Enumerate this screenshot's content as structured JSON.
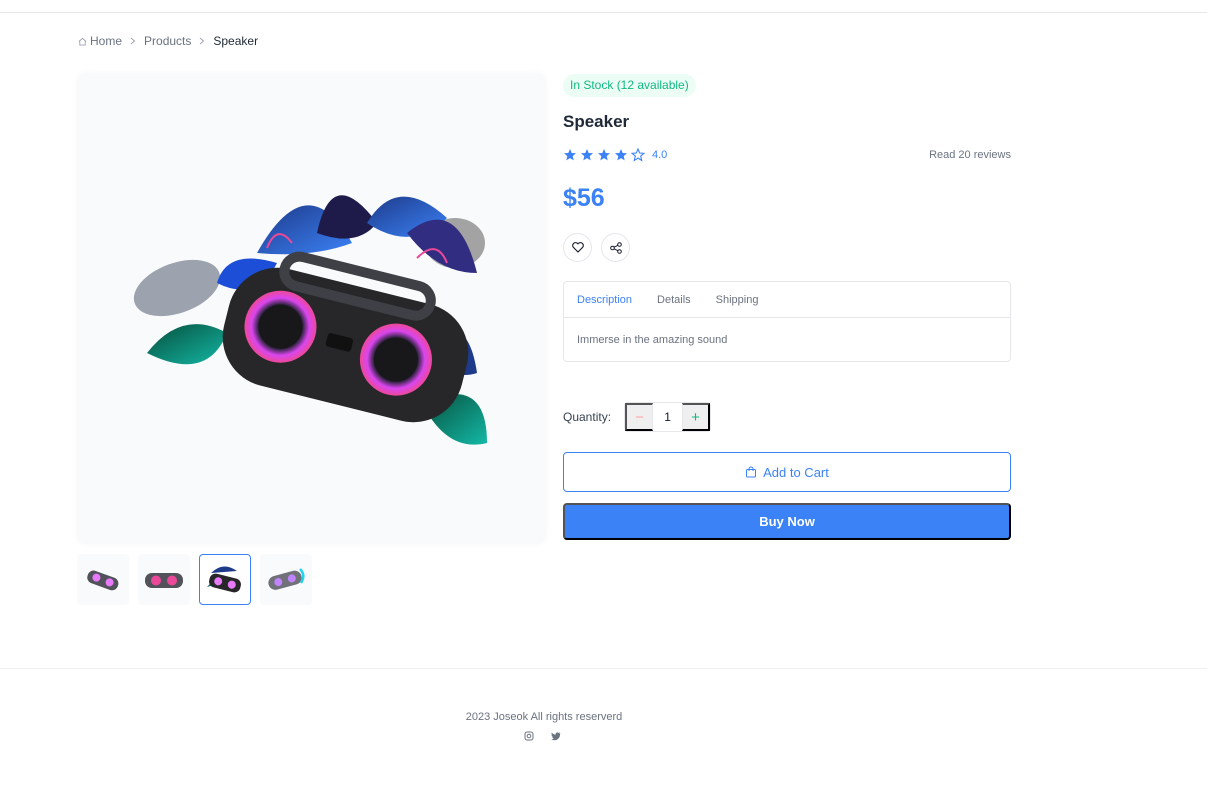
{
  "breadcrumb": {
    "home": "Home",
    "products": "Products",
    "current": "Speaker"
  },
  "product": {
    "stock": "In Stock (12 available)",
    "title": "Speaker",
    "rating": 4,
    "rating_label": "4.0",
    "reviews": "Read 20 reviews",
    "price": "$56",
    "thumbnail_count": 4,
    "active_thumbnail": 3
  },
  "tabs": [
    {
      "label": "Description",
      "active": true
    },
    {
      "label": "Details",
      "active": false
    },
    {
      "label": "Shipping",
      "active": false
    }
  ],
  "tab_content": "Immerse in the amazing sound",
  "quantity": {
    "label": "Quantity:",
    "value": "1",
    "minus": "−",
    "plus": "+"
  },
  "actions": {
    "add_to_cart": "Add to Cart",
    "buy_now": "Buy Now"
  },
  "footer": {
    "copyright": "2023 Joseok All rights reserverd"
  },
  "icons": {
    "home": "home-icon",
    "chevron": "chevron-right-icon",
    "star": "star-icon",
    "heart": "heart-icon",
    "share": "share-icon",
    "bag": "shopping-bag-icon",
    "instagram": "instagram-icon",
    "twitter": "twitter-icon"
  },
  "colors": {
    "accent": "#3b82f6",
    "success": "#10b981",
    "danger": "#fca5a5",
    "muted": "#6b7280"
  }
}
